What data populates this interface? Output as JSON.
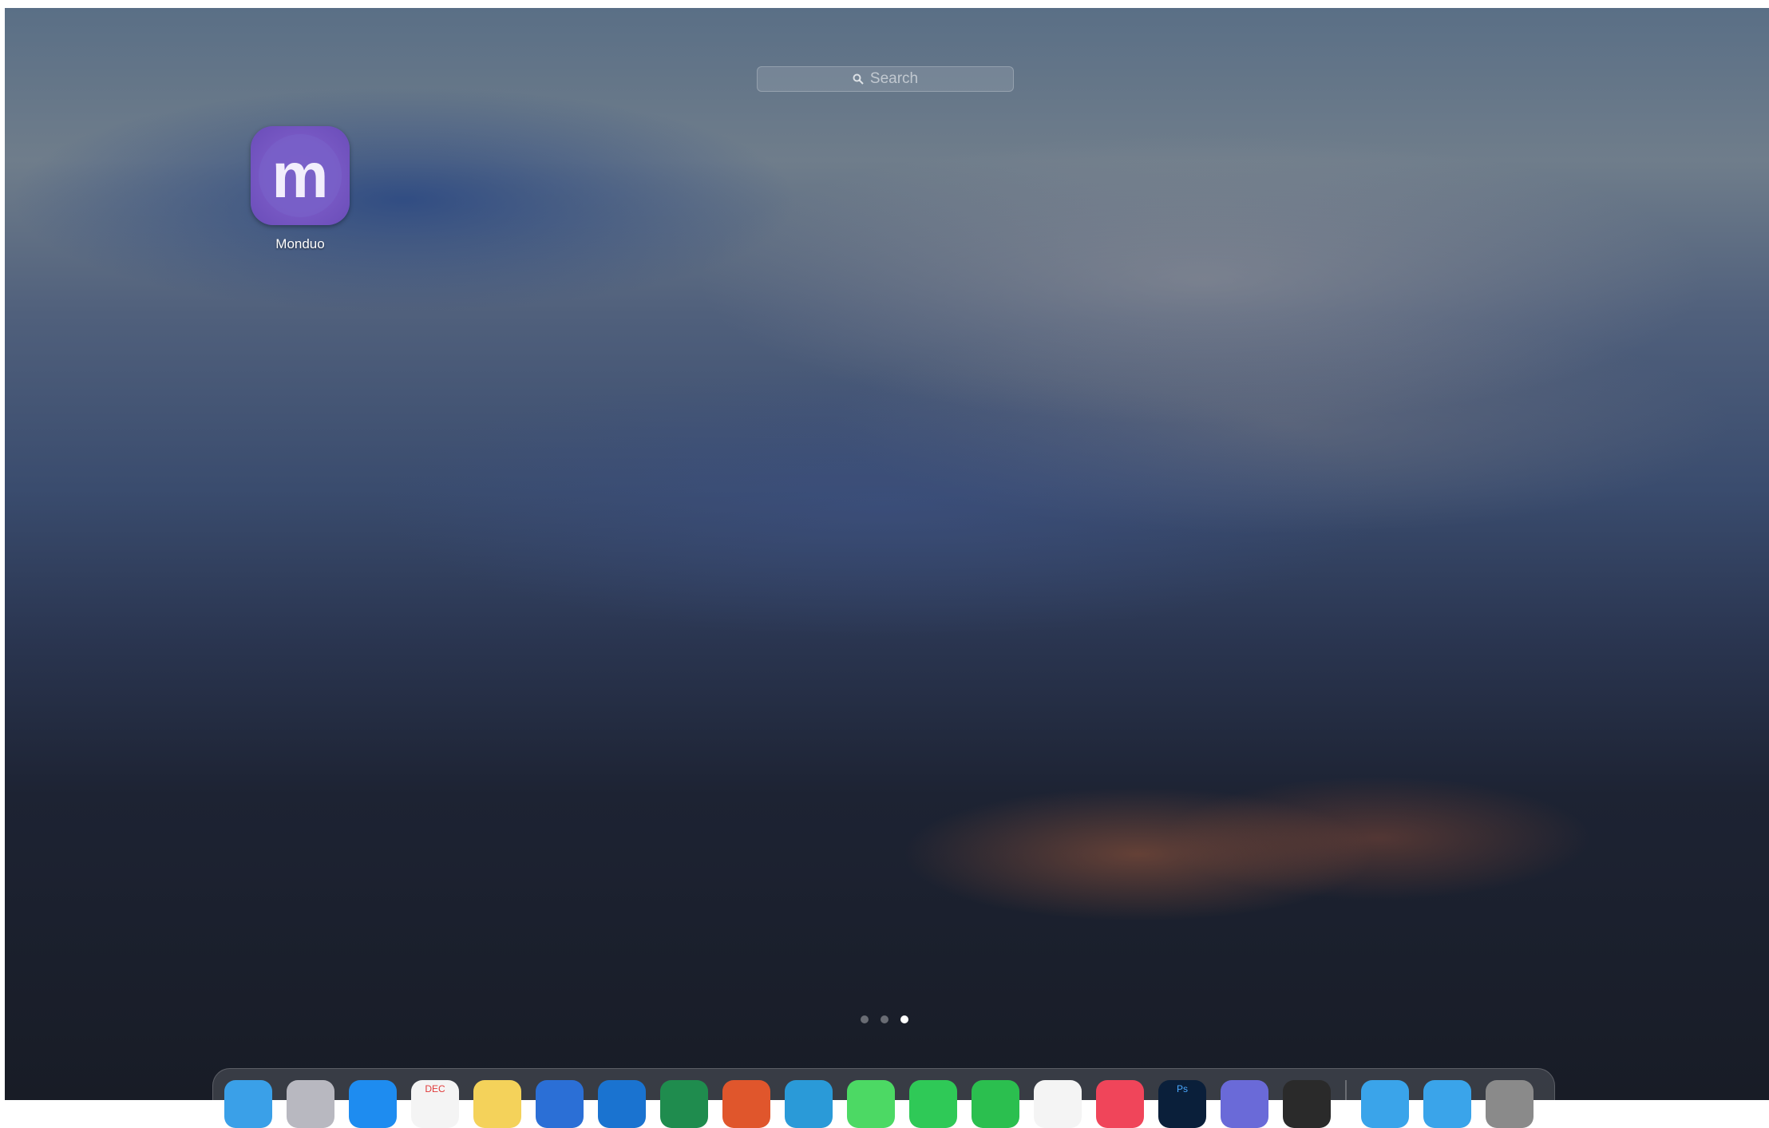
{
  "search": {
    "placeholder": "Search",
    "icon": "magnifying-glass"
  },
  "apps": [
    {
      "label": "Monduo",
      "icon_letter": "m",
      "color": "#7a5bc6"
    }
  ],
  "pagination": {
    "pages": 3,
    "current_page": 3
  },
  "dock": {
    "items": [
      {
        "name": "finder",
        "color": "#3aa0e8"
      },
      {
        "name": "launchpad",
        "color": "#b8b8c0"
      },
      {
        "name": "app-store",
        "color": "#1e8cf0"
      },
      {
        "name": "calendar",
        "color": "#f4f4f4",
        "label": "DEC"
      },
      {
        "name": "notes",
        "color": "#f4d25a"
      },
      {
        "name": "word",
        "color": "#2b6fd6"
      },
      {
        "name": "outlook",
        "color": "#1a73d0"
      },
      {
        "name": "excel",
        "color": "#1f8c4e"
      },
      {
        "name": "powerpoint",
        "color": "#e0562c"
      },
      {
        "name": "edge",
        "color": "#2a9ad8"
      },
      {
        "name": "messages",
        "color": "#4cd964"
      },
      {
        "name": "whatsapp",
        "color": "#2fc957"
      },
      {
        "name": "wechat",
        "color": "#2bbf4f"
      },
      {
        "name": "photos",
        "color": "#f4f4f4"
      },
      {
        "name": "music",
        "color": "#f0455a"
      },
      {
        "name": "photoshop",
        "color": "#0a1f3a",
        "label": "Ps"
      },
      {
        "name": "discord",
        "color": "#6a6ad8"
      },
      {
        "name": "chatgpt",
        "color": "#2a2a2a"
      },
      {
        "name": "downloads-folder",
        "color": "#3aa4ea"
      },
      {
        "name": "documents-folder",
        "color": "#3aa4ea"
      },
      {
        "name": "trash",
        "color": "#8a8a8a"
      }
    ]
  }
}
